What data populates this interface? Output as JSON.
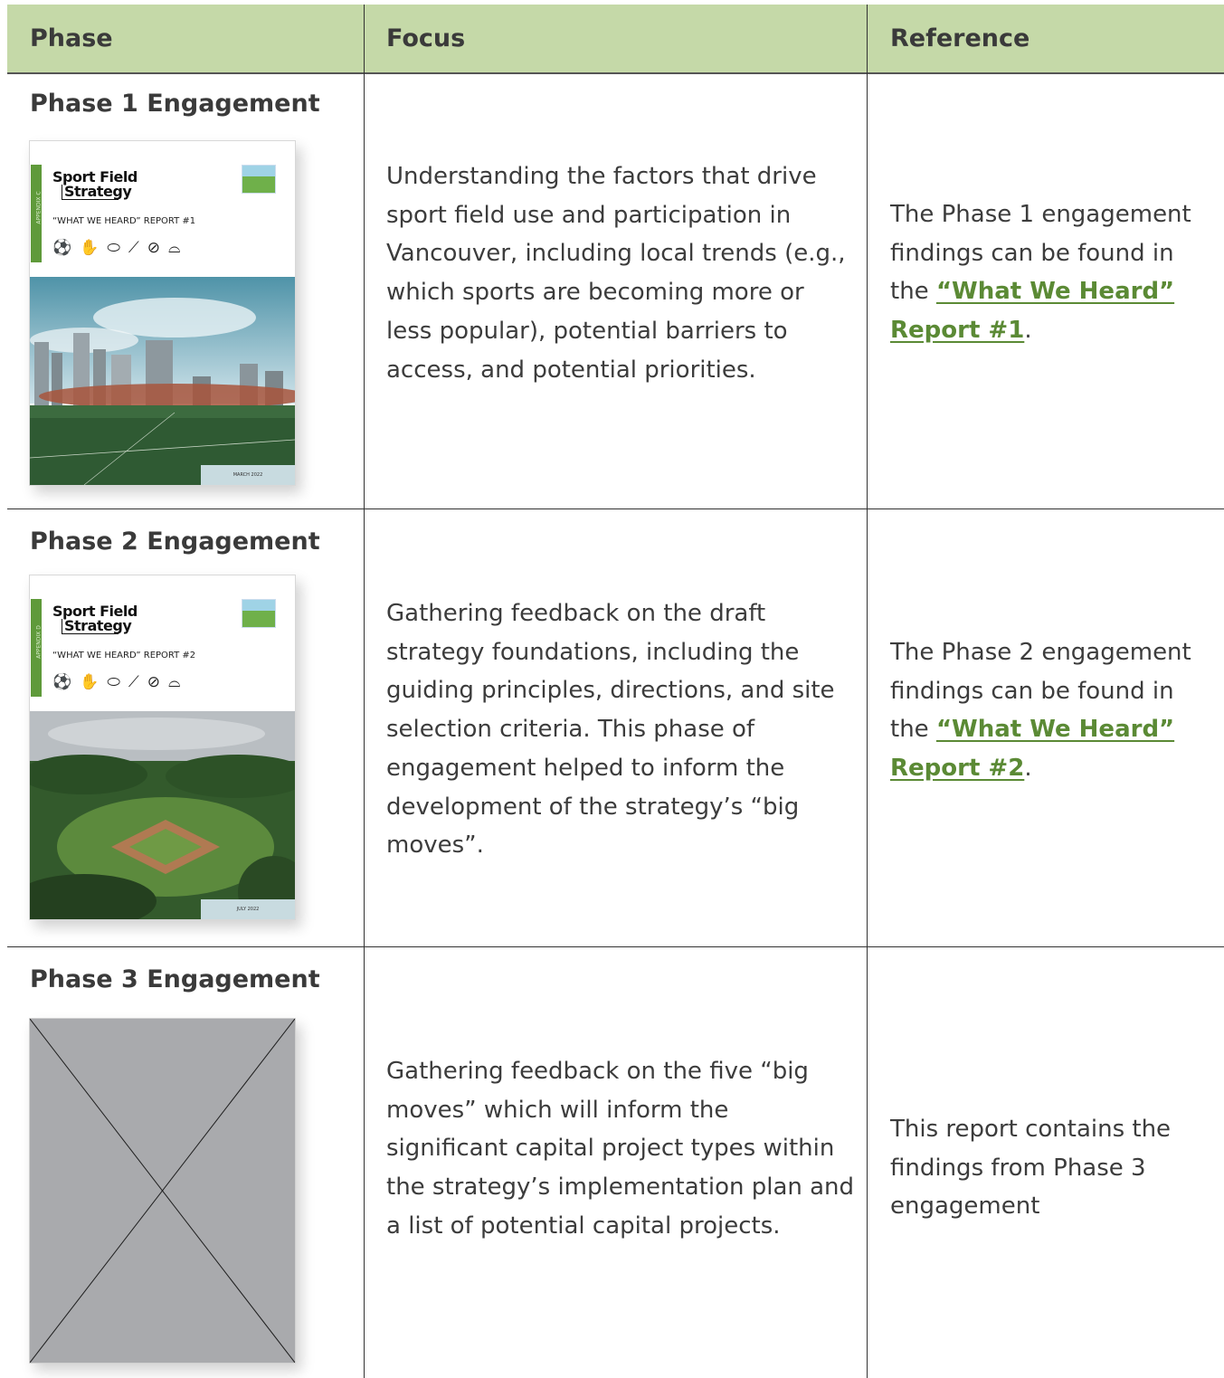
{
  "headers": {
    "phase": "Phase",
    "focus": "Focus",
    "reference": "Reference"
  },
  "rows": [
    {
      "phase": "Phase 1 Engagement",
      "cover": {
        "logo_line1": "Sport Field",
        "logo_line2": "Strategy",
        "appendix": "APPENDIX C",
        "subtitle": "“WHAT WE HEARD” REPORT #1",
        "date": "MARCH 2022",
        "icons": [
          "soccer-ball-icon",
          "glove-icon",
          "rugby-ball-icon",
          "hockey-stick-icon",
          "football-icon",
          "cleat-icon"
        ]
      },
      "focus": "Understanding the factors that drive sport field use and participation in Vancouver, including local trends (e.g., which sports are becoming more or less popular), potential barriers to access, and potential priorities.",
      "reference_prefix": "The Phase 1 engagement findings can be found in the ",
      "reference_link": "“What We Heard” Report #1",
      "reference_suffix": "."
    },
    {
      "phase": "Phase 2 Engagement",
      "cover": {
        "logo_line1": "Sport Field",
        "logo_line2": "Strategy",
        "appendix": "APPENDIX D",
        "subtitle": "“WHAT WE HEARD” REPORT #2",
        "date": "JULY 2022",
        "icons": [
          "soccer-ball-icon",
          "glove-icon",
          "rugby-ball-icon",
          "hockey-stick-icon",
          "football-icon",
          "cleat-icon"
        ]
      },
      "focus": "Gathering feedback on the draft strategy foundations, including the guiding principles, directions, and site selection criteria. This phase of engagement helped to inform the development of the strategy’s “big moves”.",
      "reference_prefix": "The Phase 2 engagement findings can be found in the ",
      "reference_link": "“What We Heard” Report #2",
      "reference_suffix": "."
    },
    {
      "phase": "Phase 3 Engagement",
      "focus": "Gathering feedback on the five “big moves” which will inform the significant capital project types within the strategy’s implementation plan and a list of potential capital projects.",
      "reference_text": "This report contains the findings from Phase 3 engagement"
    }
  ],
  "colors": {
    "header_bg": "#c5d9a8",
    "link": "#5b8a35",
    "accent_green": "#5f9a3a",
    "placeholder": "#a9aaad"
  }
}
